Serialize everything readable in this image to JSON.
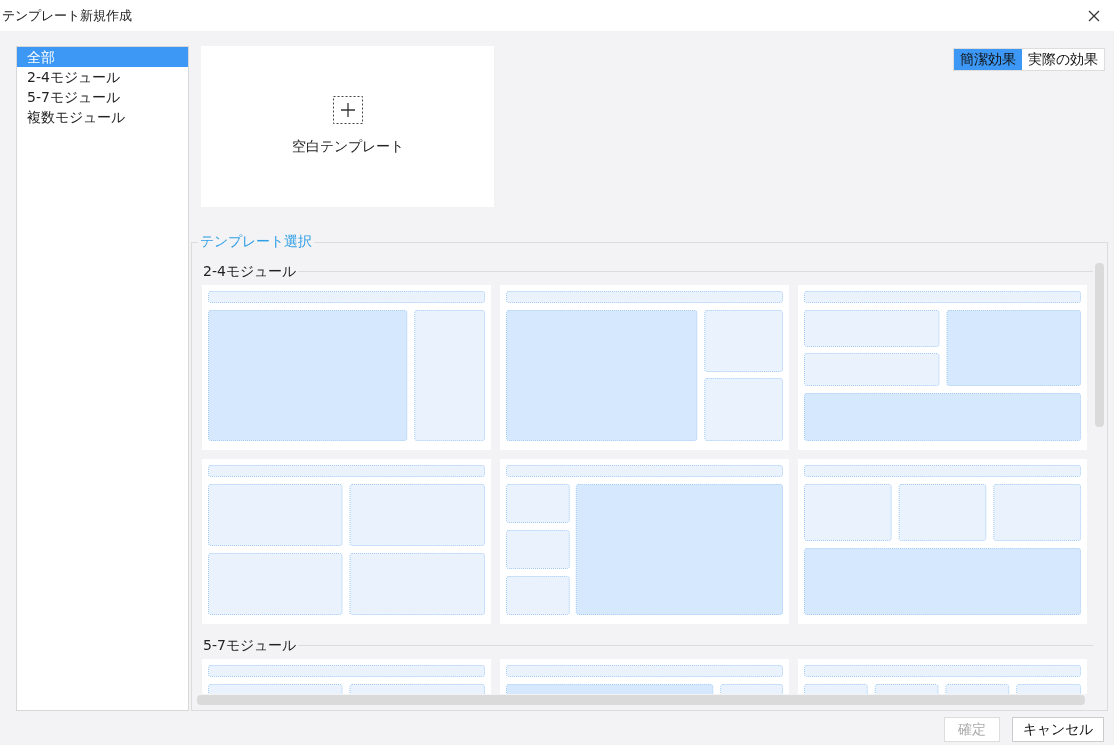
{
  "window": {
    "title": "テンプレート新規作成"
  },
  "categories": [
    {
      "label": "全部",
      "selected": true
    },
    {
      "label": "2-4モジュール",
      "selected": false
    },
    {
      "label": "5-7モジュール",
      "selected": false
    },
    {
      "label": "複数モジュール",
      "selected": false
    }
  ],
  "blank_template": {
    "label": "空白テンプレート"
  },
  "view_toggle": [
    {
      "label": "簡潔効果",
      "selected": true
    },
    {
      "label": "実際の効果",
      "selected": false
    }
  ],
  "template_panel": {
    "title": "テンプレート選択",
    "sections": [
      {
        "title": "2-4モジュール",
        "templates": [
          {
            "kind": "a"
          },
          {
            "kind": "b"
          },
          {
            "kind": "c"
          },
          {
            "kind": "d"
          },
          {
            "kind": "e"
          },
          {
            "kind": "f"
          }
        ]
      },
      {
        "title": "5-7モジュール",
        "templates": [
          {
            "kind": "g"
          },
          {
            "kind": "h"
          },
          {
            "kind": "i"
          }
        ]
      }
    ]
  },
  "buttons": [
    {
      "label": "確定",
      "disabled": true
    },
    {
      "label": "キャンセル",
      "disabled": false
    }
  ]
}
